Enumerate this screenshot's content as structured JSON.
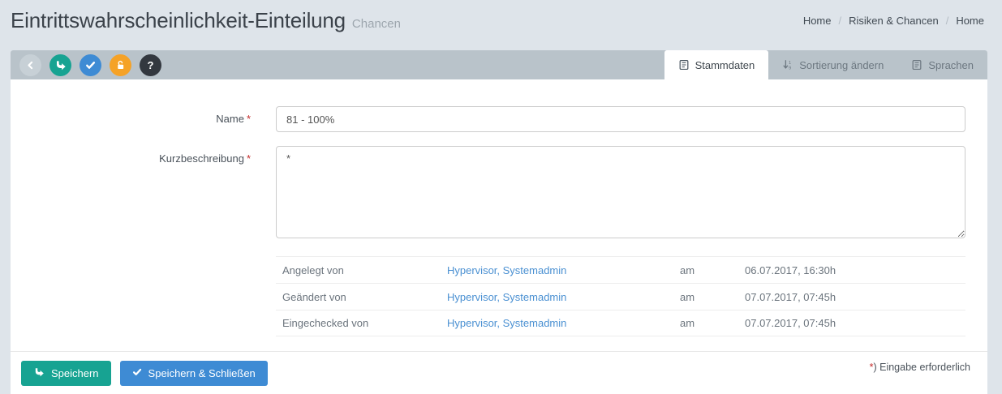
{
  "header": {
    "title": "Eintrittswahrscheinlichkeit-Einteilung",
    "subtitle": "Chancen",
    "breadcrumb_separator": "/",
    "breadcrumbs": [
      {
        "label": "Home"
      },
      {
        "label": "Risiken & Chancen"
      },
      {
        "label": "Home"
      }
    ]
  },
  "toolbar": {
    "buttons": [
      {
        "name": "back"
      },
      {
        "name": "save"
      },
      {
        "name": "check"
      },
      {
        "name": "unlock"
      },
      {
        "name": "help",
        "label": "?"
      }
    ],
    "tabs": [
      {
        "label": "Stammdaten",
        "active": true
      },
      {
        "label": "Sortierung ändern",
        "active": false
      },
      {
        "label": "Sprachen",
        "active": false
      }
    ]
  },
  "form": {
    "required_marker": "*",
    "fields": [
      {
        "label": "Name",
        "required": true,
        "value": "81 - 100%"
      },
      {
        "label": "Kurzbeschreibung",
        "required": true,
        "value": "*"
      }
    ],
    "audit_rows": [
      {
        "label": "Angelegt von",
        "user": "Hypervisor, Systemadmin",
        "am": "am",
        "date": "06.07.2017, 16:30h"
      },
      {
        "label": "Geändert von",
        "user": "Hypervisor, Systemadmin",
        "am": "am",
        "date": "07.07.2017, 07:45h"
      },
      {
        "label": "Eingechecked von",
        "user": "Hypervisor, Systemadmin",
        "am": "am",
        "date": "07.07.2017, 07:45h"
      }
    ]
  },
  "footer": {
    "save_label": "Speichern",
    "save_close_label": "Speichern & Schließen",
    "required_note_star": "*",
    "required_note_text": ") Eingabe erforderlich"
  },
  "colors": {
    "page_background": "#dee4ea",
    "toolbar_background": "#b9c3ca",
    "accent_teal": "#17a392",
    "accent_blue": "#3e8bd4",
    "accent_orange": "#f5a227",
    "accent_dark": "#33383f",
    "back_button_gray": "#c7d0d6",
    "link_blue": "#4a90d2",
    "required_red": "#c42b2b"
  }
}
